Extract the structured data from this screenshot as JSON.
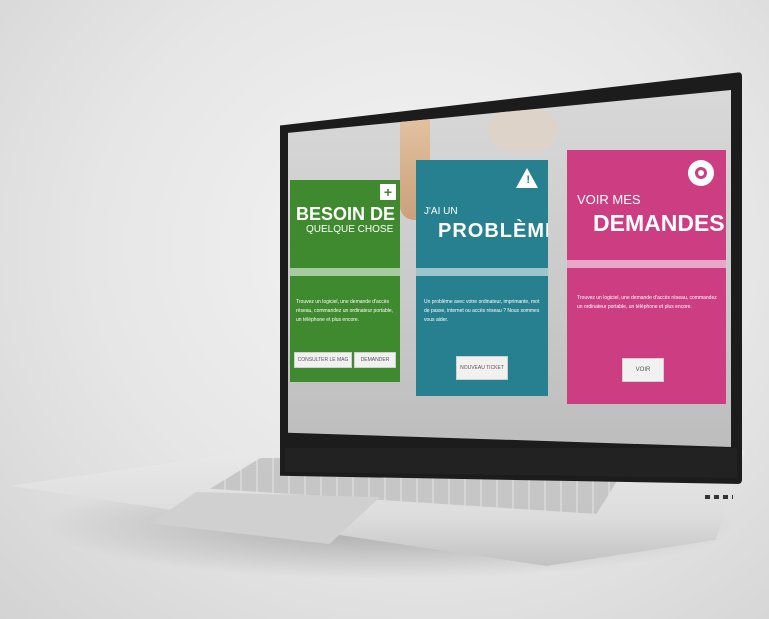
{
  "cards": {
    "besoin": {
      "title_1": "BESOIN DE",
      "title_2": "QUELQUE CHOSE",
      "description": "Trouvez un logiciel, une demande d'accès réseau, commandez un ordinateur portable, un téléphone et plus encore.",
      "button_1": "CONSULTER LE MAG",
      "button_2": "DEMANDER",
      "icon": "plus-icon",
      "color": "#3f8a2e"
    },
    "probleme": {
      "title_1": "J'AI UN",
      "title_2": "PROBLÈME",
      "description": "Un problème avec votre ordinateur, imprimante, mot de passe, internet ou accès réseau ? Nous sommes vous aider.",
      "button_1": "NOUVEAU TICKET",
      "icon": "warning-icon",
      "color": "#27808f"
    },
    "demandes": {
      "title_1": "VOIR MES",
      "title_2": "DEMANDES",
      "description": "Trouvez un logiciel, une demande d'accès réseau, commandez un ordinateur portable, un téléphone et plus encore.",
      "button_1": "VOIR",
      "icon": "eye-icon",
      "color": "#cc3d82"
    }
  }
}
